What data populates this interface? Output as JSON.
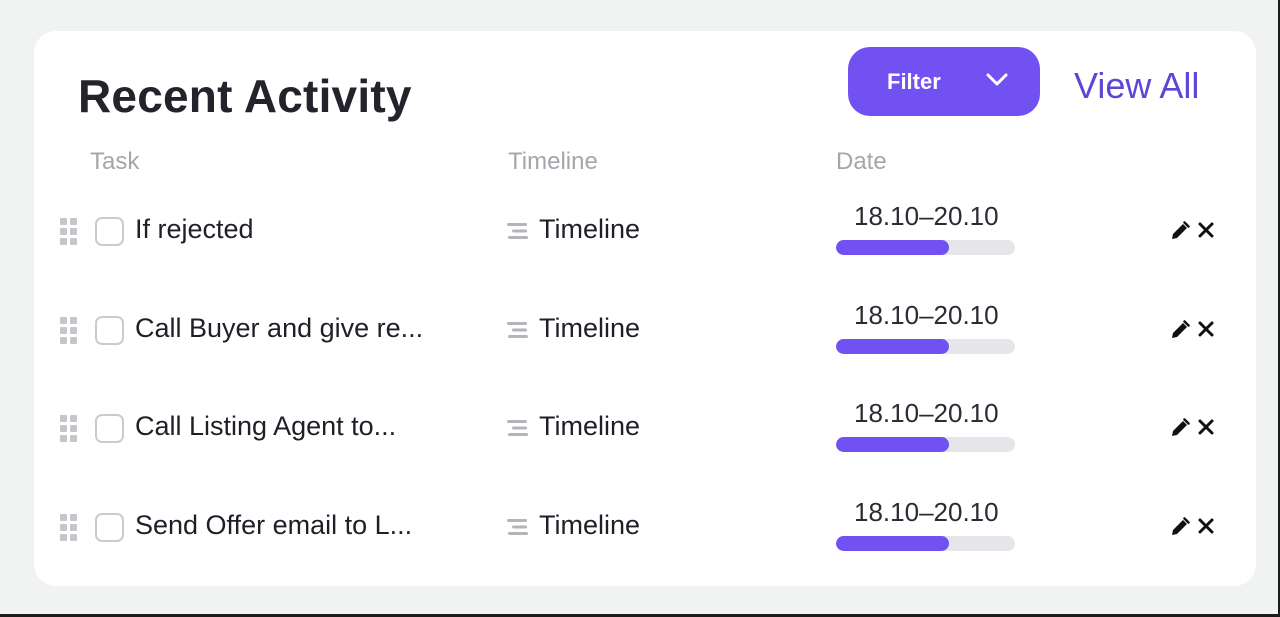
{
  "header": {
    "title": "Recent Activity",
    "filter_label": "Filter",
    "filter_icon": "chevron-down-icon",
    "view_all_label": "View All"
  },
  "columns": [
    "Task",
    "Timeline",
    "Date"
  ],
  "rows": [
    {
      "task": "If rejected",
      "timeline": "Timeline",
      "date": "18.10–20.10",
      "progress": 0.63
    },
    {
      "task": "Call Buyer and give re...",
      "timeline": "Timeline",
      "date": "18.10–20.10",
      "progress": 0.63
    },
    {
      "task": "Call Listing Agent to...",
      "timeline": "Timeline",
      "date": "18.10–20.10",
      "progress": 0.63
    },
    {
      "task": "Send Offer email to L...",
      "timeline": "Timeline",
      "date": "18.10–20.10",
      "progress": 0.63
    }
  ],
  "colors": {
    "accent": "#7251f2",
    "link": "#5b47d6",
    "progress_track": "#e6e6ea",
    "header_text": "#a3a6ab"
  }
}
